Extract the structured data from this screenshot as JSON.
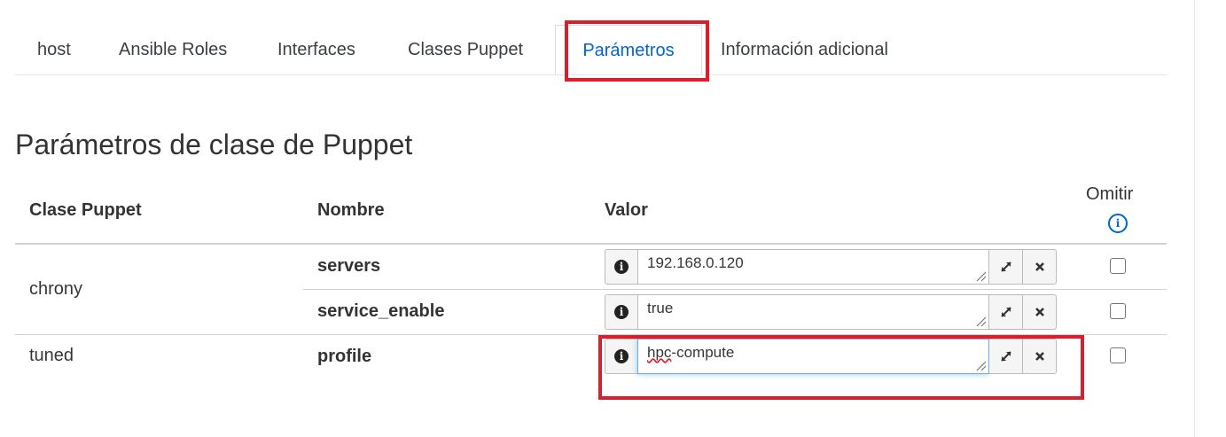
{
  "tabs": [
    {
      "label": "host"
    },
    {
      "label": "Ansible Roles"
    },
    {
      "label": "Interfaces"
    },
    {
      "label": "Clases Puppet"
    },
    {
      "label": "Parámetros"
    },
    {
      "label": "Información adicional"
    }
  ],
  "section_title": "Parámetros de clase de Puppet",
  "table": {
    "headers": {
      "puppet_class": "Clase Puppet",
      "name": "Nombre",
      "value": "Valor",
      "omit": "Omitir"
    },
    "rows": [
      {
        "class": "chrony",
        "name": "servers",
        "value": "192.168.0.120",
        "omit": false
      },
      {
        "class": "",
        "name": "service_enable",
        "value": "true",
        "omit": false
      },
      {
        "class": "tuned",
        "name": "profile",
        "value_misspelled_part": "hpc",
        "value_rest": "-compute",
        "omit": false
      }
    ]
  },
  "colors": {
    "accent": "#0066cc",
    "highlight": "#d9202a"
  }
}
